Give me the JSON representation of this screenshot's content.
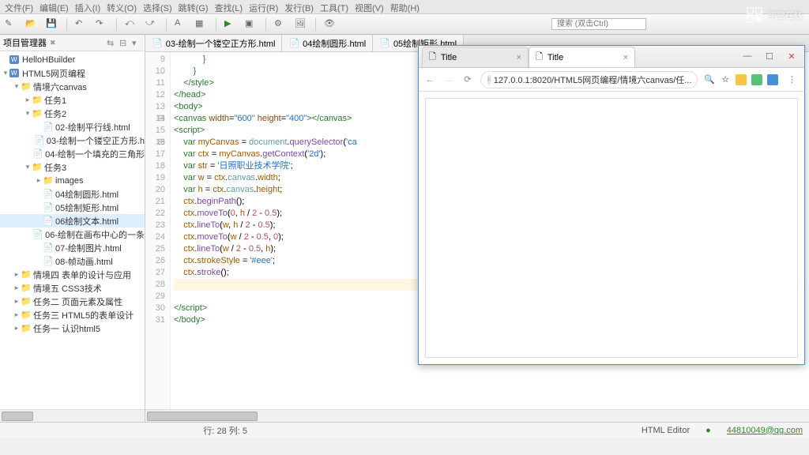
{
  "menu": [
    "文件(F)",
    "编辑(E)",
    "插入(I)",
    "转义(O)",
    "选择(S)",
    "跳转(G)",
    "查找(L)",
    "运行(R)",
    "发行(B)",
    "工具(T)",
    "视图(V)",
    "帮助(H)"
  ],
  "search_placeholder": "搜索 (双击Ctrl)",
  "panel_title": "项目管理器",
  "tree": [
    {
      "d": 0,
      "tw": "",
      "ic": "W",
      "lbl": "HelloHBuilder"
    },
    {
      "d": 0,
      "tw": "▾",
      "ic": "W",
      "lbl": "HTML5网页编程"
    },
    {
      "d": 1,
      "tw": "▾",
      "ic": "📁",
      "lbl": "情境六canvas"
    },
    {
      "d": 2,
      "tw": "▸",
      "ic": "📁",
      "lbl": "任务1"
    },
    {
      "d": 2,
      "tw": "▾",
      "ic": "📁",
      "lbl": "任务2"
    },
    {
      "d": 3,
      "tw": "",
      "ic": "📄",
      "lbl": "02-绘制平行线.html"
    },
    {
      "d": 3,
      "tw": "",
      "ic": "📄",
      "lbl": "03-绘制一个镂空正方形.h"
    },
    {
      "d": 3,
      "tw": "",
      "ic": "📄",
      "lbl": "04-绘制一个填充的三角形"
    },
    {
      "d": 2,
      "tw": "▾",
      "ic": "📁",
      "lbl": "任务3"
    },
    {
      "d": 3,
      "tw": "▸",
      "ic": "📁",
      "lbl": "images"
    },
    {
      "d": 3,
      "tw": "",
      "ic": "📄",
      "lbl": "04绘制圆形.html"
    },
    {
      "d": 3,
      "tw": "",
      "ic": "📄",
      "lbl": "05绘制矩形.html"
    },
    {
      "d": 3,
      "tw": "",
      "ic": "📄",
      "lbl": "06绘制文本.html",
      "sel": true
    },
    {
      "d": 3,
      "tw": "",
      "ic": "📄",
      "lbl": "06-绘制在画布中心的一条"
    },
    {
      "d": 3,
      "tw": "",
      "ic": "📄",
      "lbl": "07-绘制图片.html"
    },
    {
      "d": 3,
      "tw": "",
      "ic": "📄",
      "lbl": "08-帧动画.html"
    },
    {
      "d": 1,
      "tw": "▸",
      "ic": "📁",
      "lbl": "情境四 表单的设计与应用"
    },
    {
      "d": 1,
      "tw": "▸",
      "ic": "📁",
      "lbl": "情境五 CSS3技术"
    },
    {
      "d": 1,
      "tw": "▸",
      "ic": "📁",
      "lbl": "任务二 页面元素及属性"
    },
    {
      "d": 1,
      "tw": "▸",
      "ic": "📁",
      "lbl": "任务三 HTML5的表单设计"
    },
    {
      "d": 1,
      "tw": "▸",
      "ic": "📁",
      "lbl": "任务一 认识html5"
    }
  ],
  "tabs": [
    "03-绘制一个镂空正方形.html",
    "04绘制圆形.html",
    "05绘制矩形.html"
  ],
  "code": [
    {
      "n": 9,
      "html": "            <span class='t-tag'>}</span>"
    },
    {
      "n": 10,
      "html": "        <span class='t-tag'>}</span>"
    },
    {
      "n": 11,
      "html": "    <span class='t-tag'>&lt;/style&gt;</span>"
    },
    {
      "n": 12,
      "html": "<span class='t-tag'>&lt;/head&gt;</span>"
    },
    {
      "n": 13,
      "html": "<span class='t-tag'>&lt;body&gt;</span>",
      "fold": true
    },
    {
      "n": 14,
      "html": "<span class='t-tag'>&lt;canvas</span> <span class='t-attr'>width</span>=<span class='t-str'>\"600\"</span> <span class='t-attr'>height</span>=<span class='t-str'>\"400\"</span><span class='t-tag'>&gt;&lt;/canvas&gt;</span>"
    },
    {
      "n": 15,
      "html": "<span class='t-tag'>&lt;script&gt;</span>",
      "fold": true
    },
    {
      "n": 16,
      "html": "    <span class='t-kw'>var</span> <span class='t-var'>myCanvas</span> = <span class='t-obj'>document</span>.<span class='t-fn'>querySelector</span>(<span class='t-str'>'ca</span>"
    },
    {
      "n": 17,
      "html": "    <span class='t-kw'>var</span> <span class='t-var'>ctx</span> = <span class='t-var'>myCanvas</span>.<span class='t-fn'>getContext</span>(<span class='t-str'>'2d'</span>);"
    },
    {
      "n": 18,
      "html": "    <span class='t-kw'>var</span> <span class='t-var'>str</span> = <span class='t-str'>'日照职业技术学院'</span>;"
    },
    {
      "n": 19,
      "html": "    <span class='t-kw'>var</span> <span class='t-var'>w</span> = <span class='t-var'>ctx</span>.<span class='t-obj'>canvas</span>.<span class='t-var'>width</span>;"
    },
    {
      "n": 20,
      "html": "    <span class='t-kw'>var</span> <span class='t-var'>h</span> = <span class='t-var'>ctx</span>.<span class='t-obj'>canvas</span>.<span class='t-var'>height</span>;"
    },
    {
      "n": 21,
      "html": "    <span class='t-var'>ctx</span>.<span class='t-fn'>beginPath</span>();"
    },
    {
      "n": 22,
      "html": "    <span class='t-var'>ctx</span>.<span class='t-fn'>moveTo</span>(<span class='t-num'>0</span>, <span class='t-var'>h</span> / <span class='t-num'>2</span> - <span class='t-num'>0.5</span>);"
    },
    {
      "n": 23,
      "html": "    <span class='t-var'>ctx</span>.<span class='t-fn'>lineTo</span>(<span class='t-var'>w</span>, <span class='t-var'>h</span> / <span class='t-num'>2</span> - <span class='t-num'>0.5</span>);"
    },
    {
      "n": 24,
      "html": "    <span class='t-var'>ctx</span>.<span class='t-fn'>moveTo</span>(<span class='t-var'>w</span> / <span class='t-num'>2</span> - <span class='t-num'>0.5</span>, <span class='t-num'>0</span>);"
    },
    {
      "n": 25,
      "html": "    <span class='t-var'>ctx</span>.<span class='t-fn'>lineTo</span>(<span class='t-var'>w</span> / <span class='t-num'>2</span> - <span class='t-num'>0.5</span>, <span class='t-var'>h</span>);"
    },
    {
      "n": 26,
      "html": "    <span class='t-var'>ctx</span>.<span class='t-var'>strokeStyle</span> = <span class='t-str'>'#eee'</span>;"
    },
    {
      "n": 27,
      "html": "    <span class='t-var'>ctx</span>.<span class='t-fn'>stroke</span>();"
    },
    {
      "n": 28,
      "html": "    ",
      "cur": true
    },
    {
      "n": 29,
      "html": ""
    },
    {
      "n": 30,
      "html": "<span class='t-tag'>&lt;/script&gt;</span>"
    },
    {
      "n": 31,
      "html": "<span class='t-tag'>&lt;/body&gt;</span>"
    }
  ],
  "status": {
    "pos": "行: 28 列: 5",
    "mode": "HTML Editor",
    "user": "44810049@qq.com"
  },
  "browser": {
    "tabs": [
      "Title",
      "Title"
    ],
    "url": "127.0.0.1:8020/HTML5网页编程/情境六canvas/任...",
    "star": "☆"
  },
  "watermark": "学堂在线"
}
